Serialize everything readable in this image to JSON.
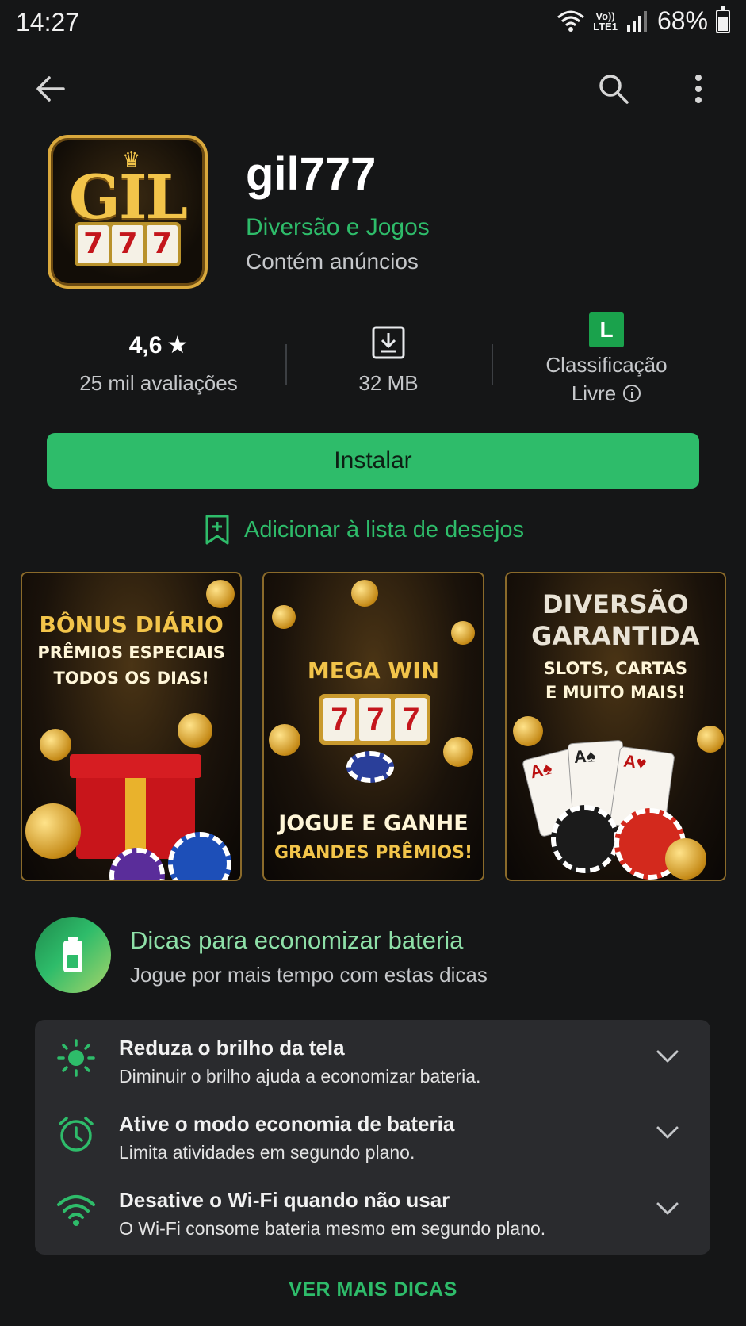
{
  "status_bar": {
    "time": "14:27",
    "network_label_top": "Vo))",
    "network_label_bottom": "LTE1",
    "battery_percent": "68%",
    "battery_level": 0.68
  },
  "toolbar": {
    "back_icon": "arrow-back-icon",
    "search_icon": "search-icon",
    "more_icon": "more-vert-icon"
  },
  "app": {
    "title": "gil777",
    "developer": "Diversão e Jogos",
    "ads_notice": "Contém anúncios",
    "icon_text": "GIL",
    "icon_reels": [
      "7",
      "7",
      "7"
    ]
  },
  "stats": {
    "rating_value": "4,6",
    "rating_star": "★",
    "reviews": "25 mil avaliações",
    "size": "32 MB",
    "content_badge": "L",
    "content_label_line1": "Classificação",
    "content_label_line2": "Livre"
  },
  "actions": {
    "install_label": "Instalar",
    "wishlist_label": "Adicionar à lista de desejos"
  },
  "screenshots": [
    {
      "line1": "BÔNUS DIÁRIO",
      "line2": "PRÊMIOS ESPECIAIS",
      "line3": "TODOS OS DIAS!"
    },
    {
      "header": "MEGA WIN",
      "reels": [
        "7",
        "7",
        "7"
      ],
      "line1": "JOGUE E GANHE",
      "line2": "GRANDES PRÊMIOS!"
    },
    {
      "line1": "DIVERSÃO",
      "line2": "GARANTIDA",
      "line3": "SLOTS, CARTAS",
      "line4": "E MUITO MAIS!"
    }
  ],
  "battery_tips": {
    "title": "Dicas para economizar bateria",
    "subtitle": "Jogue por mais tempo com estas dicas",
    "items": [
      {
        "title": "Reduza o brilho da tela",
        "desc": "Diminuir o brilho ajuda a economizar bateria.",
        "icon": "brightness-icon"
      },
      {
        "title": "Ative o modo economia de bateria",
        "desc": "Limita atividades em segundo plano.",
        "icon": "alarm-clock-icon"
      },
      {
        "title": "Desative o Wi-Fi quando não usar",
        "desc": "O Wi-Fi consome bateria mesmo em segundo plano.",
        "icon": "wifi-icon"
      }
    ],
    "more_label": "VER MAIS DICAS"
  },
  "colors": {
    "background": "#151617",
    "accent_green": "#2ebc6a",
    "card_bg": "#2a2b2e"
  }
}
